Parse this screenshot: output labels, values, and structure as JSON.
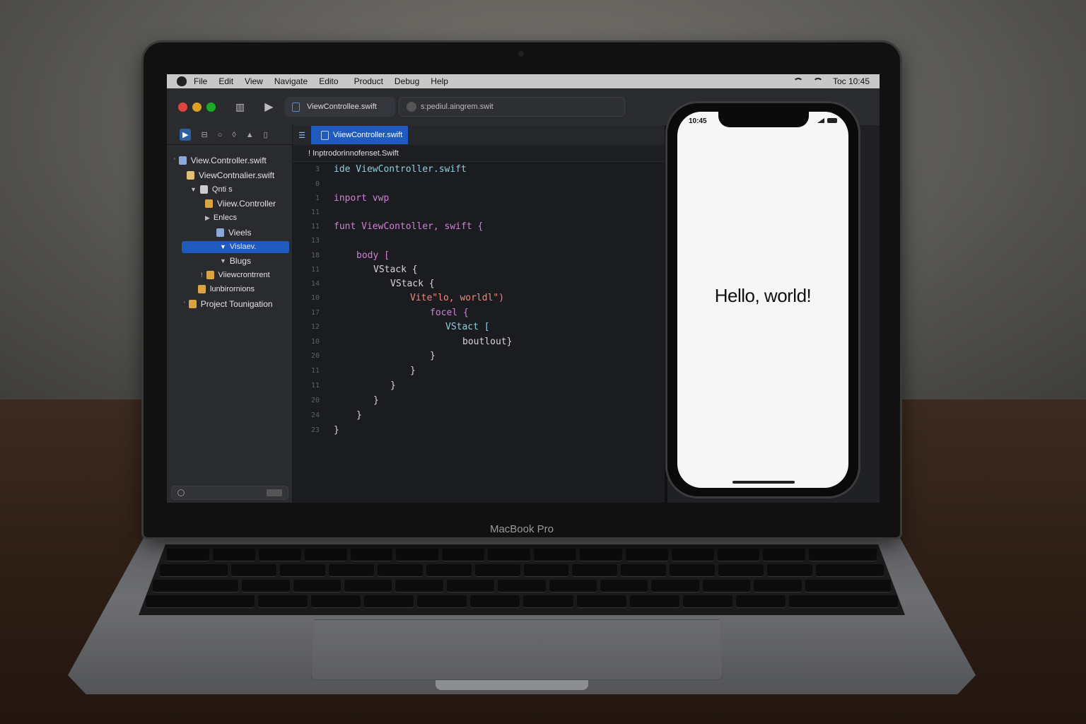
{
  "menubar": {
    "items": [
      "File",
      "Edit",
      "View",
      "Navigate",
      "Edito",
      "Product",
      "Debug",
      "Help"
    ],
    "clock": "Toc 10:45"
  },
  "toolbar": {
    "tab1": "ViewControllee.swift",
    "tab2": "s:pediul.aingrem.swit"
  },
  "navigator": {
    "items": [
      {
        "label": "View.Controller.swift",
        "icon": "doc-icon",
        "disclosure": "'"
      },
      {
        "label": "ViewContnalier.swift",
        "icon": "folder-icon",
        "disclosure": ""
      },
      {
        "label": "Qnti s",
        "icon": "doc-icon",
        "disclosure": "▼"
      },
      {
        "label": "Viiew.Controller",
        "icon": "swift-icon",
        "disclosure": ""
      },
      {
        "label": "Enlecs",
        "icon": "",
        "disclosure": "▶"
      },
      {
        "label": "Vieels",
        "icon": "doc-icon",
        "disclosure": ""
      },
      {
        "label": "Vislaev.",
        "icon": "",
        "disclosure": "▼"
      },
      {
        "label": "Blugs",
        "icon": "",
        "disclosure": "▼"
      },
      {
        "label": "Viiewcrontrrent",
        "icon": "swift-icon",
        "disclosure": "!"
      },
      {
        "label": "lunbirornions",
        "icon": "swift-icon",
        "disclosure": ""
      },
      {
        "label": "Project Tounigation",
        "icon": "swift-icon",
        "disclosure": "'"
      }
    ]
  },
  "editor": {
    "tab": "ViiewController.swift",
    "jumpbar": "! Inptrodorinnofenset.Swift",
    "lines": [
      {
        "n": "3",
        "text": "ide ViewController.swift"
      },
      {
        "n": "0",
        "text": ""
      },
      {
        "n": "1",
        "text": "inport vwp"
      },
      {
        "n": "11",
        "text": ""
      },
      {
        "n": "11",
        "text": "funt ViewContoller, swift {"
      },
      {
        "n": "13",
        "text": ""
      },
      {
        "n": "18",
        "text": "body ["
      },
      {
        "n": "11",
        "text": "VStack {"
      },
      {
        "n": "14",
        "text": "VStack {"
      },
      {
        "n": "10",
        "text": "Vite\"lo, worldl\")"
      },
      {
        "n": "17",
        "text": "focel {"
      },
      {
        "n": "12",
        "text": "VStact ["
      },
      {
        "n": "10",
        "text": "boutlout}"
      },
      {
        "n": "20",
        "text": "}"
      },
      {
        "n": "11",
        "text": "}"
      },
      {
        "n": "11",
        "text": "}"
      },
      {
        "n": "20",
        "text": "}"
      },
      {
        "n": "24",
        "text": "}"
      },
      {
        "n": "23",
        "text": "}"
      }
    ]
  },
  "preview": {
    "time": "10:45",
    "text": "Hello, world!"
  },
  "laptop": {
    "brand": "MacBook Pro"
  },
  "colors": {
    "accent": "#1f5bbf",
    "keyword": "#d27fd8",
    "string": "#f08a79",
    "type": "#8ecfe0"
  }
}
